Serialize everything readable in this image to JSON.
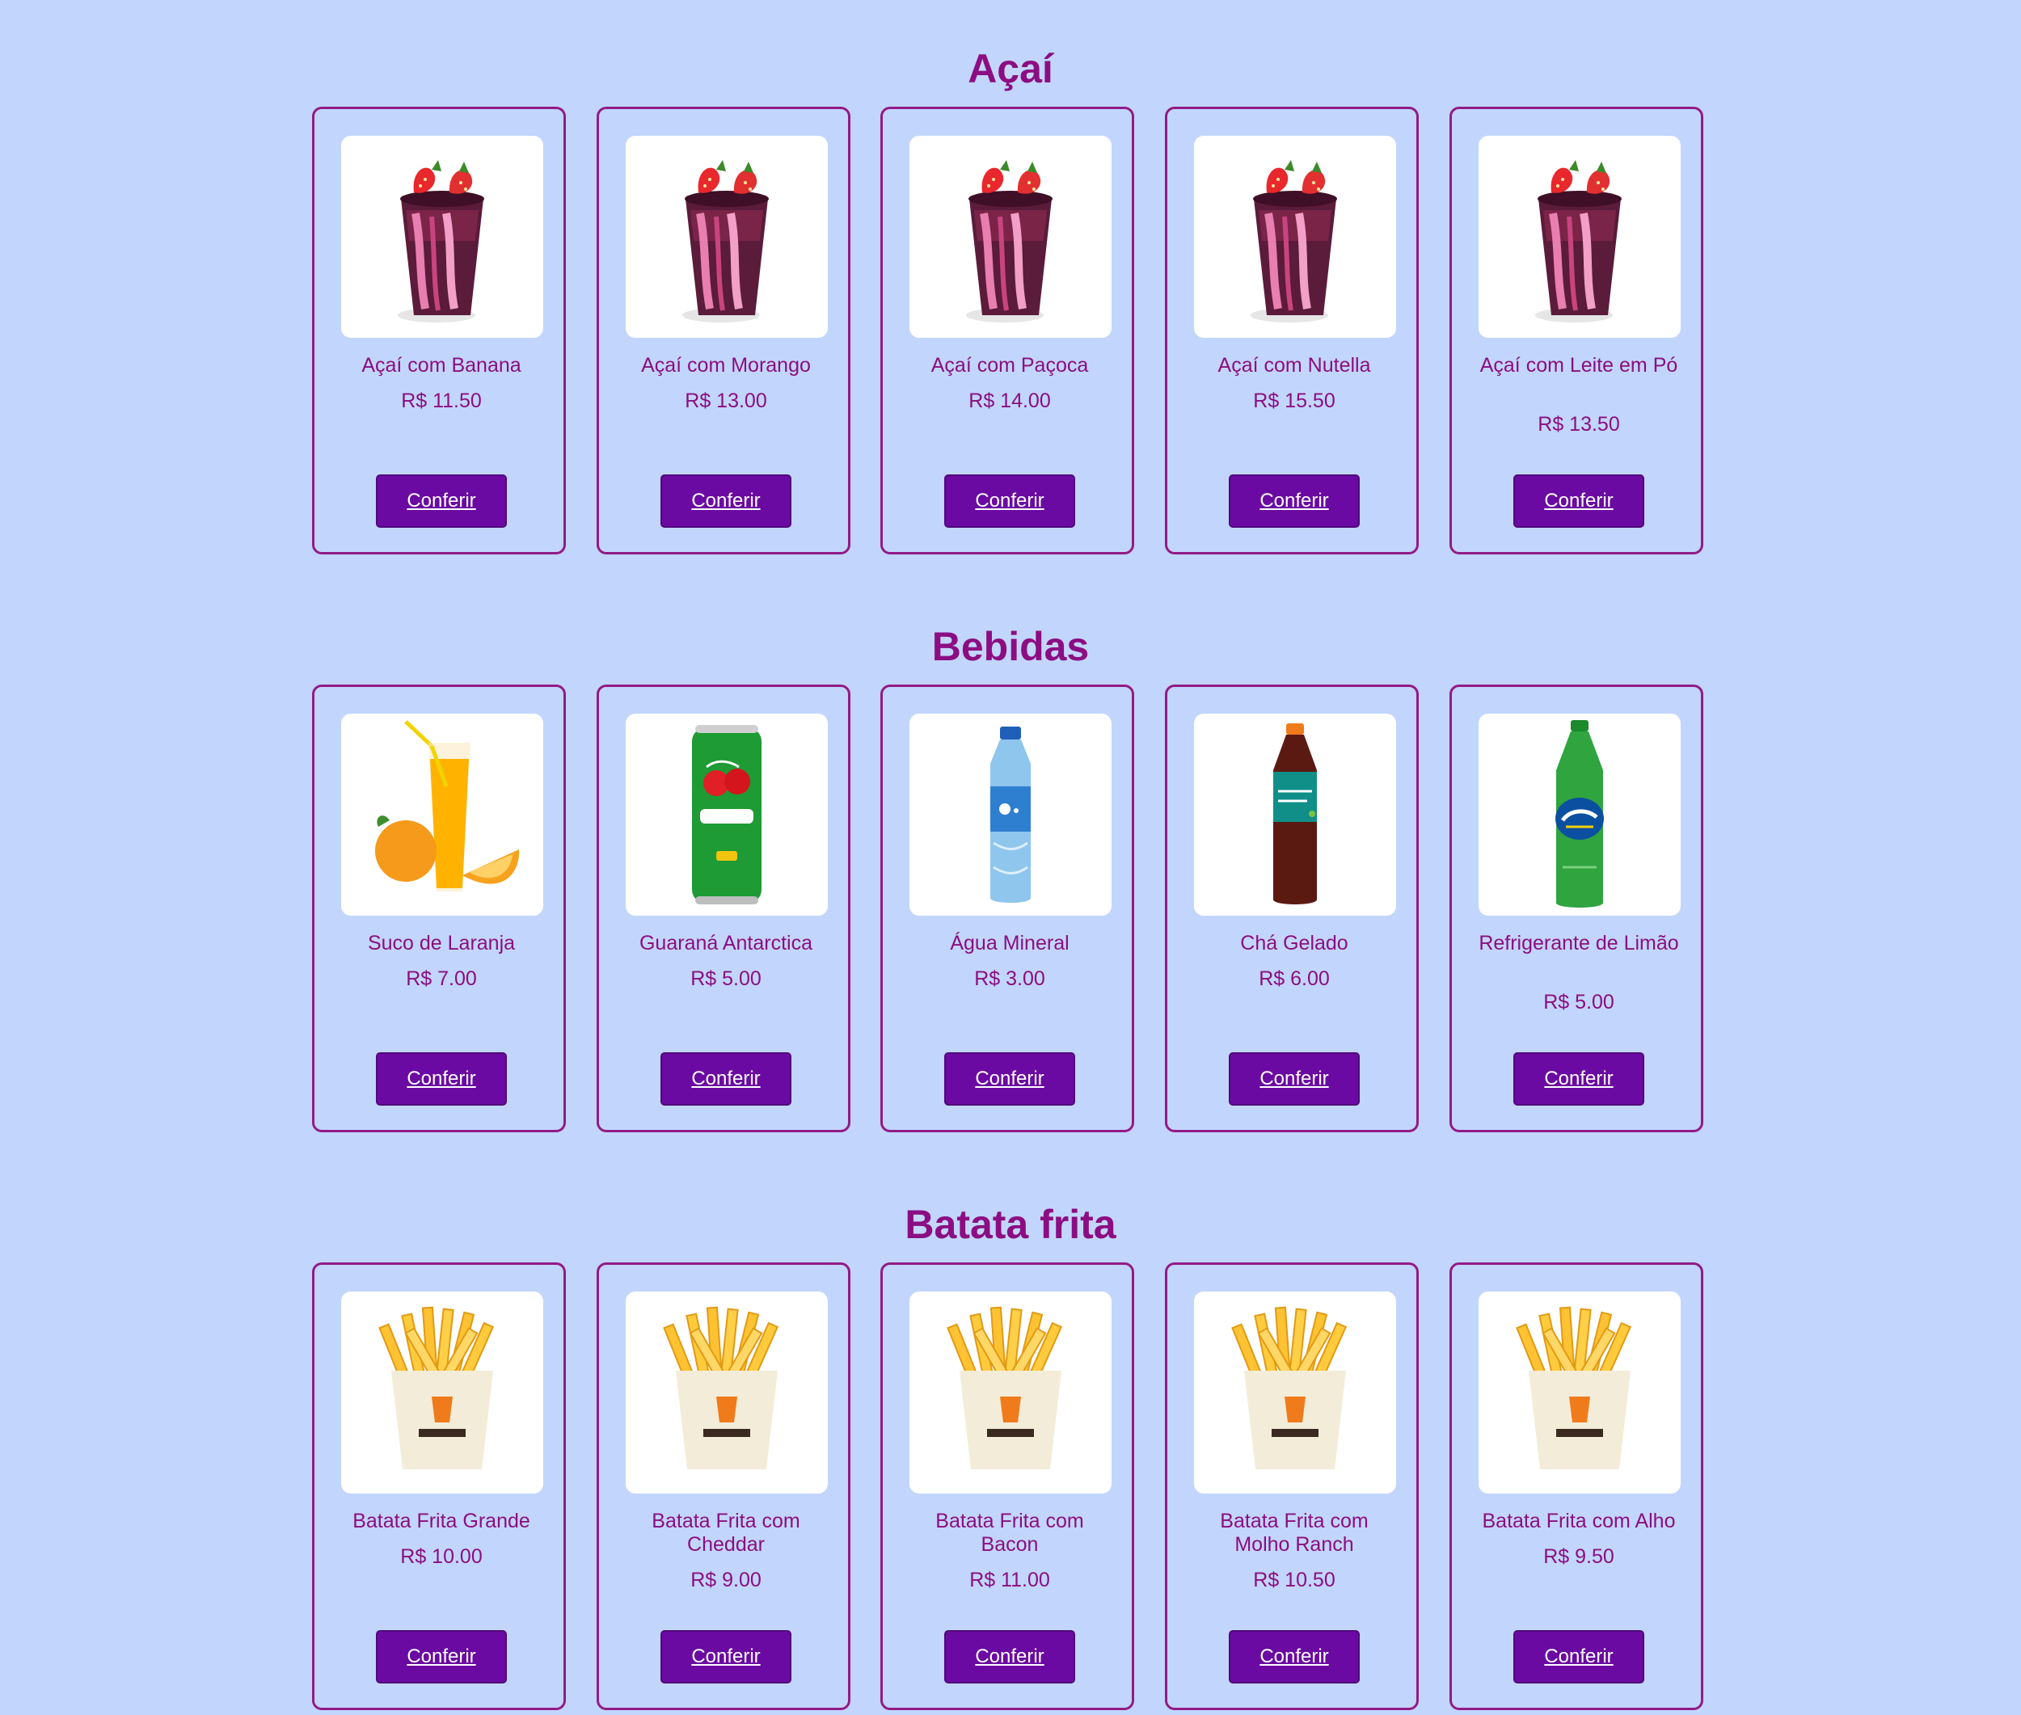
{
  "sections": [
    {
      "title": "Açaí",
      "items": [
        {
          "name": "Açaí com Banana",
          "price": "R$ 11.50",
          "button": "Conferir",
          "image": "acai-cup-image"
        },
        {
          "name": "Açaí com Morango",
          "price": "R$ 13.00",
          "button": "Conferir",
          "image": "acai-cup-image"
        },
        {
          "name": "Açaí com Paçoca",
          "price": "R$ 14.00",
          "button": "Conferir",
          "image": "acai-cup-image"
        },
        {
          "name": "Açaí com Nutella",
          "price": "R$ 15.50",
          "button": "Conferir",
          "image": "acai-cup-image"
        },
        {
          "name": "Açaí com Leite em Pó",
          "price": "R$ 13.50",
          "button": "Conferir",
          "image": "acai-cup-image"
        }
      ]
    },
    {
      "title": "Bebidas",
      "items": [
        {
          "name": "Suco de Laranja",
          "price": "R$ 7.00",
          "button": "Conferir",
          "image": "orange-juice-image"
        },
        {
          "name": "Guaraná Antarctica",
          "price": "R$ 5.00",
          "button": "Conferir",
          "image": "soda-can-image"
        },
        {
          "name": "Água Mineral",
          "price": "R$ 3.00",
          "button": "Conferir",
          "image": "water-bottle-image"
        },
        {
          "name": "Chá Gelado",
          "price": "R$ 6.00",
          "button": "Conferir",
          "image": "iced-tea-bottle-image"
        },
        {
          "name": "Refrigerante de Limão",
          "price": "R$ 5.00",
          "button": "Conferir",
          "image": "lemon-soda-bottle-image"
        }
      ]
    },
    {
      "title": "Batata frita",
      "items": [
        {
          "name": "Batata Frita Grande",
          "price": "R$ 10.00",
          "button": "Conferir",
          "image": "fries-box-image"
        },
        {
          "name": "Batata Frita com Cheddar",
          "price": "R$ 9.00",
          "button": "Conferir",
          "image": "fries-box-image"
        },
        {
          "name": "Batata Frita com Bacon",
          "price": "R$ 11.00",
          "button": "Conferir",
          "image": "fries-box-image"
        },
        {
          "name": "Batata Frita com Molho Ranch",
          "price": "R$ 10.50",
          "button": "Conferir",
          "image": "fries-box-image"
        },
        {
          "name": "Batata Frita com Alho",
          "price": "R$ 9.50",
          "button": "Conferir",
          "image": "fries-box-image"
        }
      ]
    }
  ],
  "colors": {
    "background": "#c2d6fd",
    "accent": "#8c0d83",
    "button": "#6b0aa2"
  }
}
